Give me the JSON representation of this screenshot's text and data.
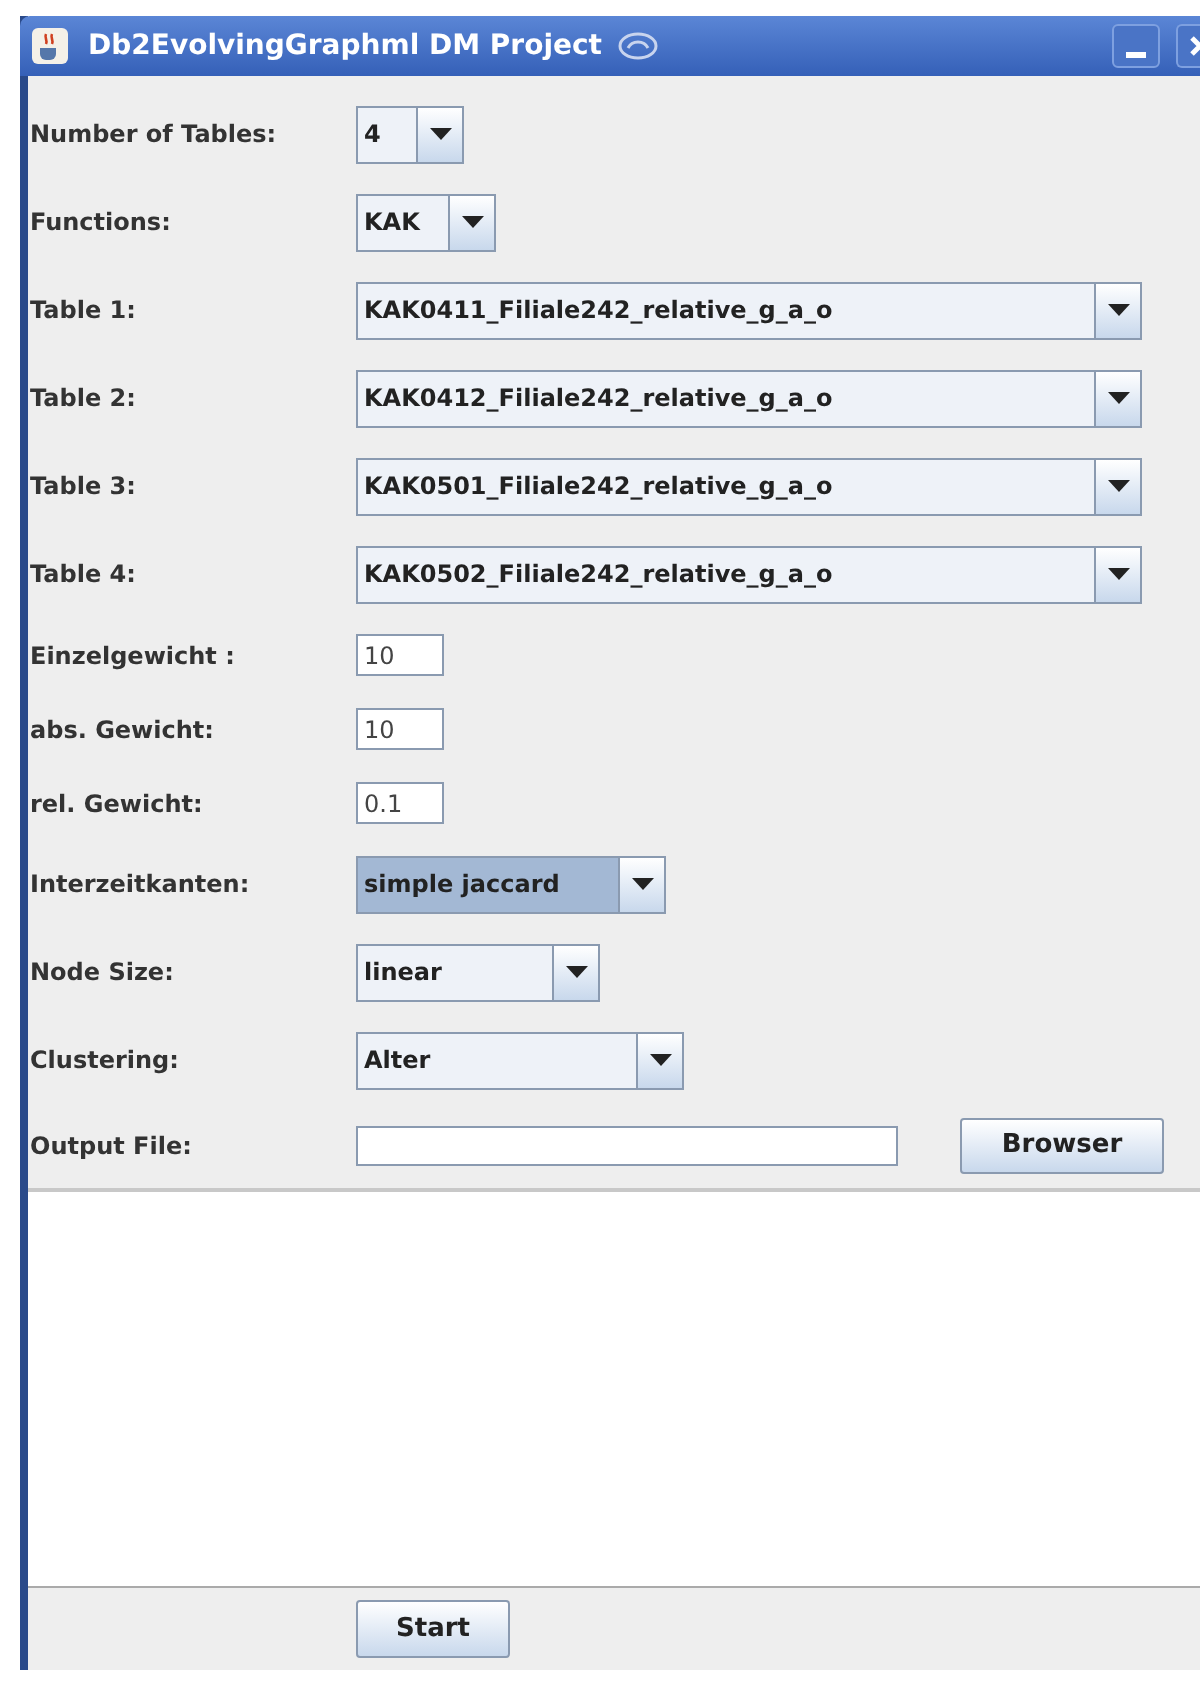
{
  "window": {
    "title": "Db2EvolvingGraphml DM Project"
  },
  "fields": [
    {
      "label": "Number of Tables:",
      "kind": "combo",
      "value": "4",
      "focused": false
    },
    {
      "label": "Functions:",
      "kind": "combo",
      "value": "KAK",
      "focused": false
    },
    {
      "label": "Table 1:",
      "kind": "combo",
      "value": "KAK0411_Filiale242_relative_g_a_o",
      "focused": false
    },
    {
      "label": "Table 2:",
      "kind": "combo",
      "value": "KAK0412_Filiale242_relative_g_a_o",
      "focused": false
    },
    {
      "label": "Table 3:",
      "kind": "combo",
      "value": "KAK0501_Filiale242_relative_g_a_o",
      "focused": false
    },
    {
      "label": "Table 4:",
      "kind": "combo",
      "value": "KAK0502_Filiale242_relative_g_a_o",
      "focused": false
    },
    {
      "label": "Einzelgewicht :",
      "kind": "text",
      "value": "10"
    },
    {
      "label": "abs. Gewicht:",
      "kind": "text",
      "value": "10"
    },
    {
      "label": "rel. Gewicht:",
      "kind": "text",
      "value": "0.1"
    },
    {
      "label": "Interzeitkanten:",
      "kind": "combo",
      "value": "simple jaccard",
      "focused": true
    },
    {
      "label": "Node Size:",
      "kind": "combo",
      "value": "linear",
      "focused": false
    },
    {
      "label": "Clustering:",
      "kind": "combo",
      "value": "Alter",
      "focused": false
    }
  ],
  "output_file": {
    "label": "Output File:"
  },
  "browse_button": "Browser",
  "start_button": "Start"
}
